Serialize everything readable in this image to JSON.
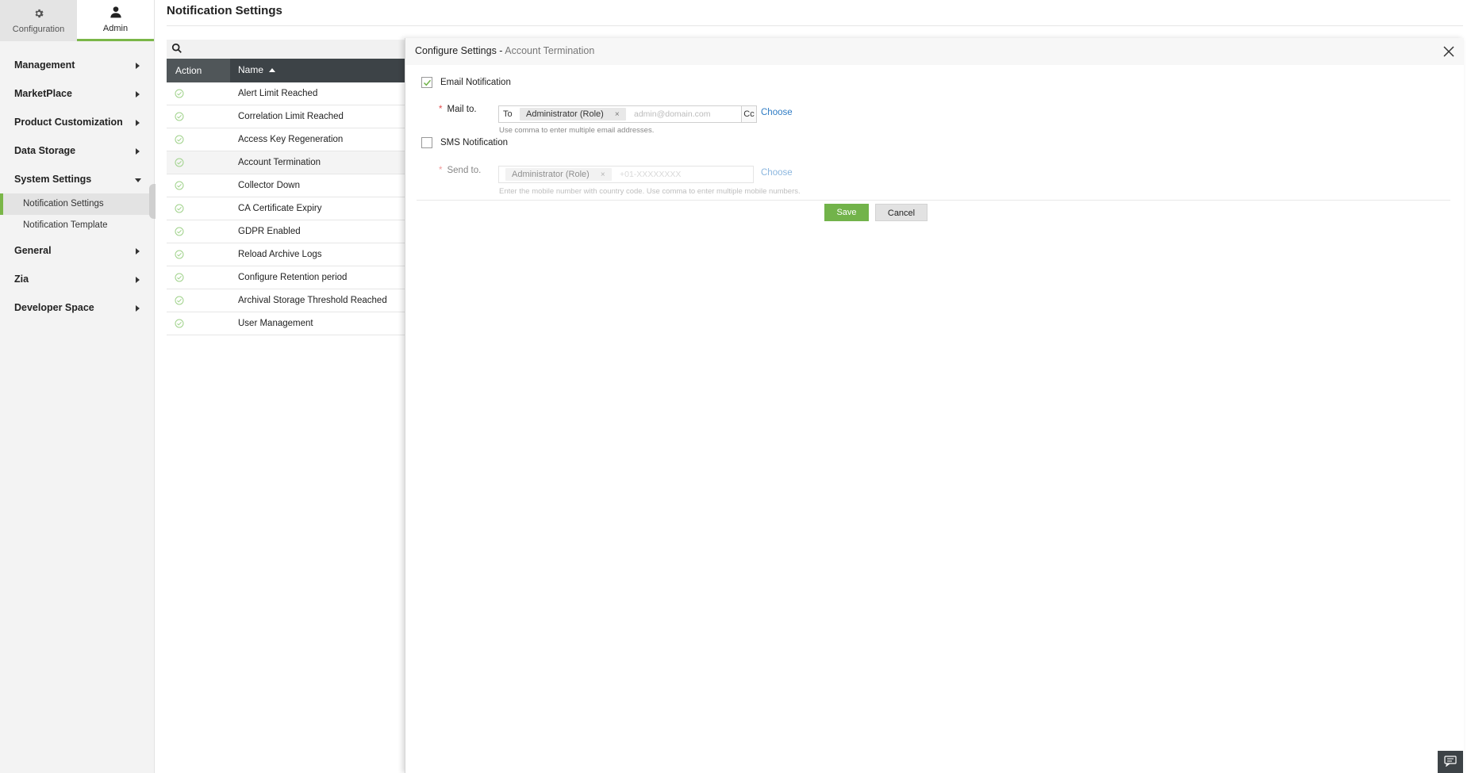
{
  "sidebar": {
    "tabs": [
      {
        "label": "Configuration",
        "icon": "gear-icon"
      },
      {
        "label": "Admin",
        "icon": "user-icon"
      }
    ],
    "menu": {
      "management": "Management",
      "marketplace": "MarketPlace",
      "product_customization": "Product Customization",
      "data_storage": "Data Storage",
      "system_settings": "System Settings",
      "notification_settings": "Notification Settings",
      "notification_template": "Notification Template",
      "general": "General",
      "zia": "Zia",
      "developer_space": "Developer Space"
    }
  },
  "page": {
    "title": "Notification Settings"
  },
  "list": {
    "columns": {
      "action": "Action",
      "name": "Name"
    },
    "rows": [
      "Alert Limit Reached",
      "Correlation Limit Reached",
      "Access Key Regeneration",
      "Account Termination",
      "Collector Down",
      "CA Certificate Expiry",
      "GDPR Enabled",
      "Reload Archive Logs",
      "Configure Retention period",
      "Archival Storage Threshold Reached",
      "User Management"
    ],
    "selected": "Account Termination"
  },
  "panel": {
    "title_prefix": "Configure Settings - ",
    "title_context": "Account Termination",
    "email": {
      "label": "Email Notification",
      "checked": true,
      "mail_to_label": "Mail to.",
      "to_prefix": "To",
      "chip": "Administrator (Role)",
      "placeholder": "admin@domain.com",
      "cc": "Cc",
      "choose": "Choose",
      "hint": "Use comma to enter multiple email addresses."
    },
    "sms": {
      "label": "SMS Notification",
      "checked": false,
      "send_to_label": "Send to.",
      "chip": "Administrator (Role)",
      "placeholder": "+01-XXXXXXXX",
      "choose": "Choose",
      "hint": "Enter the mobile number with country code. Use comma to enter multiple mobile numbers."
    },
    "buttons": {
      "save": "Save",
      "cancel": "Cancel"
    }
  },
  "colors": {
    "accent": "#72b34a",
    "link": "#2d7bc4",
    "header_dark": "#3d4347"
  }
}
